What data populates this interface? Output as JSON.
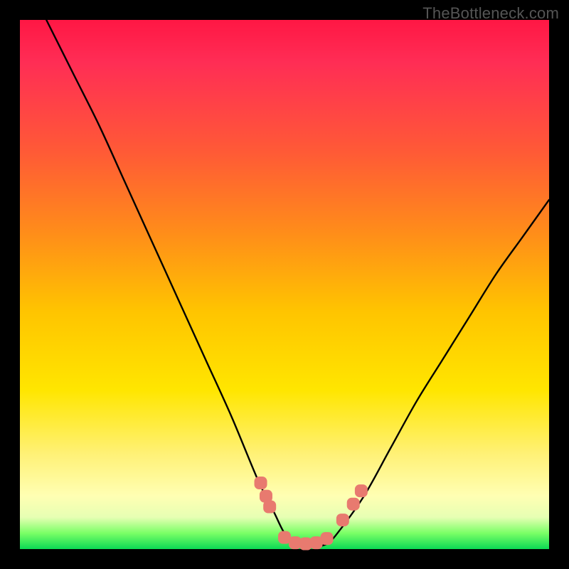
{
  "watermark": "TheBottleneck.com",
  "chart_data": {
    "type": "line",
    "title": "",
    "xlabel": "",
    "ylabel": "",
    "xlim": [
      0,
      100
    ],
    "ylim": [
      0,
      100
    ],
    "series": [
      {
        "name": "bottleneck-curve",
        "x": [
          5,
          10,
          15,
          20,
          25,
          30,
          35,
          40,
          45,
          48,
          50,
          52,
          54,
          56,
          58,
          60,
          65,
          70,
          75,
          80,
          85,
          90,
          95,
          100
        ],
        "y": [
          100,
          90,
          80,
          69,
          58,
          47,
          36,
          25,
          13,
          7,
          3,
          1,
          0.5,
          0.5,
          1,
          3,
          10,
          19,
          28,
          36,
          44,
          52,
          59,
          66
        ]
      }
    ],
    "markers": [
      {
        "x": 45.5,
        "y": 12.5
      },
      {
        "x": 46.5,
        "y": 10.0
      },
      {
        "x": 47.2,
        "y": 8.0
      },
      {
        "x": 50.0,
        "y": 2.2
      },
      {
        "x": 52.0,
        "y": 1.2
      },
      {
        "x": 54.0,
        "y": 1.0
      },
      {
        "x": 56.0,
        "y": 1.2
      },
      {
        "x": 58.0,
        "y": 2.0
      },
      {
        "x": 61.0,
        "y": 5.5
      },
      {
        "x": 63.0,
        "y": 8.5
      },
      {
        "x": 64.5,
        "y": 11.0
      }
    ],
    "background_gradient": {
      "top": "#ff1744",
      "mid": "#ffe600",
      "bottom": "#0bd954"
    }
  }
}
